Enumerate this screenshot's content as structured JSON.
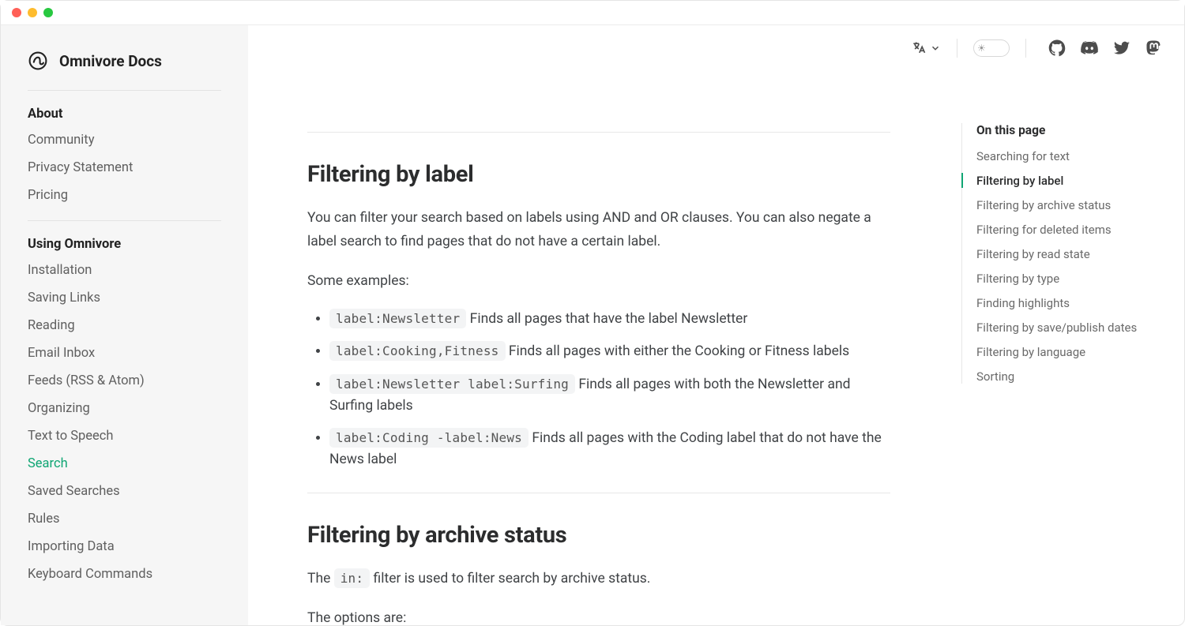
{
  "brand": {
    "title": "Omnivore Docs"
  },
  "sidebar": {
    "section1": {
      "title": "About",
      "links": [
        "Community",
        "Privacy Statement",
        "Pricing"
      ]
    },
    "section2": {
      "title": "Using Omnivore",
      "links": [
        "Installation",
        "Saving Links",
        "Reading",
        "Email Inbox",
        "Feeds (RSS & Atom)",
        "Organizing",
        "Text to Speech",
        "Search",
        "Saved Searches",
        "Rules",
        "Importing Data",
        "Keyboard Commands"
      ],
      "activeIndex": 7
    }
  },
  "toc": {
    "title": "On this page",
    "items": [
      "Searching for text",
      "Filtering by label",
      "Filtering by archive status",
      "Filtering for deleted items",
      "Filtering by read state",
      "Filtering by type",
      "Finding highlights",
      "Filtering by save/publish dates",
      "Filtering by language",
      "Sorting"
    ],
    "activeIndex": 1
  },
  "content": {
    "h1": "Filtering by label",
    "p1": "You can filter your search based on labels using AND and OR clauses. You can also negate a label search to find pages that do not have a certain label.",
    "p2": "Some examples:",
    "ex1_code": "label:Newsletter",
    "ex1_text": " Finds all pages that have the label Newsletter",
    "ex2_code": "label:Cooking,Fitness",
    "ex2_text": " Finds all pages with either the Cooking or Fitness labels",
    "ex3_code": "label:Newsletter label:Surfing",
    "ex3_text": " Finds all pages with both the Newsletter and Surfing labels",
    "ex4_code": "label:Coding -label:News",
    "ex4_text": " Finds all pages with the Coding label that do not have the News label",
    "h2": "Filtering by archive status",
    "p3a": "The ",
    "p3_code": "in:",
    "p3b": " filter is used to filter search by archive status.",
    "p4": "The options are:"
  }
}
